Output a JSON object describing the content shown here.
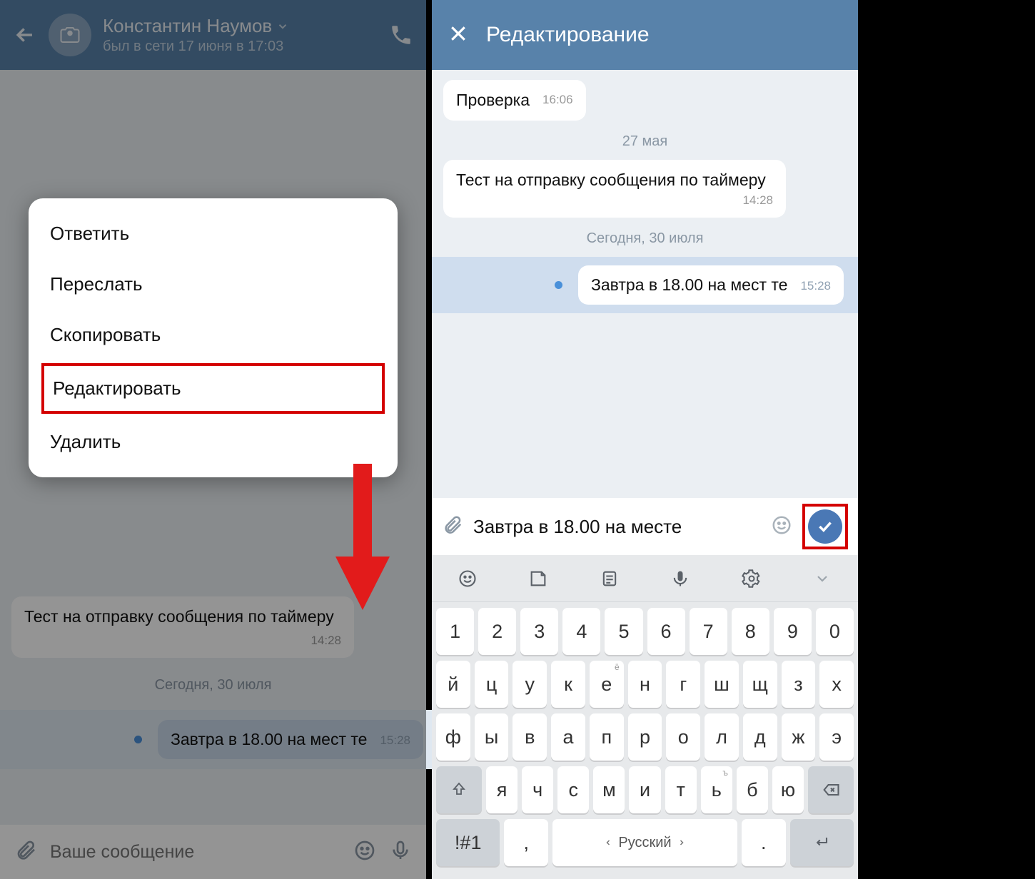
{
  "left": {
    "contact_name": "Константин Наумов",
    "last_seen": "был в сети 17 июня в 17:03",
    "msg1_text": "Тест на отправку сообщения по таймеру",
    "msg1_time": "14:28",
    "date_sep": "Сегодня, 30 июля",
    "msg2_text": "Завтра в 18.00 на мест те",
    "msg2_time": "15:28",
    "input_placeholder": "Ваше сообщение",
    "menu": {
      "reply": "Ответить",
      "forward": "Переслать",
      "copy": "Скопировать",
      "edit": "Редактировать",
      "delete": "Удалить"
    }
  },
  "right": {
    "title": "Редактирование",
    "msg0_text": "Проверка",
    "msg0_time": "16:06",
    "date1": "27 мая",
    "msg1_text": "Тест на отправку сообщения по таймеру",
    "msg1_time": "14:28",
    "date2": "Сегодня, 30 июля",
    "msg2_text": "Завтра в 18.00 на мест те",
    "msg2_time": "15:28",
    "edit_value": "Завтра в 18.00 на месте"
  },
  "keyboard": {
    "row1": [
      "1",
      "2",
      "3",
      "4",
      "5",
      "6",
      "7",
      "8",
      "9",
      "0"
    ],
    "row2": [
      "й",
      "ц",
      "у",
      "к",
      "е",
      "н",
      "г",
      "ш",
      "щ",
      "з",
      "х"
    ],
    "row3": [
      "ф",
      "ы",
      "в",
      "а",
      "п",
      "р",
      "о",
      "л",
      "д",
      "ж",
      "э"
    ],
    "row4": [
      "я",
      "ч",
      "с",
      "м",
      "и",
      "т",
      "ь",
      "б",
      "ю"
    ],
    "sym_key": "!#1",
    "comma": ",",
    "space_label": "Русский",
    "dot": ".",
    "sup_e": "ё",
    "sup_hard": "ъ"
  }
}
